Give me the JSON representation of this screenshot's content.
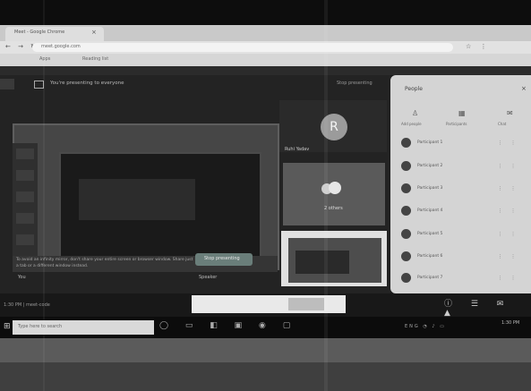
{
  "browser": {
    "tab_title": "Meet - Google Chrome",
    "tab_close": "×",
    "nav": "← → ↻",
    "url": "meet.google.com",
    "actions": "☆ ⋮",
    "bookmarks": [
      "Apps",
      "Reading list"
    ]
  },
  "meet": {
    "banner": "You're presenting to everyone",
    "stop_presenting_top": "Stop presenting",
    "slide_title": "",
    "warning": "To avoid an infinity mirror, don't share your entire screen or browser window. Share just a tab or a different window instead.",
    "stop_presenting_button": "Stop presenting",
    "you_label": "You",
    "speaker_label": "Speaker",
    "meeting_code": "1:30 PM | meet-code",
    "tiles": [
      {
        "initial": "R",
        "name": "Ruhi Yadav"
      },
      {
        "initial": "",
        "name": "2 others"
      }
    ]
  },
  "people_panel": {
    "title": "People",
    "close": "×",
    "tabs": [
      {
        "icon": "♙",
        "label": "Add people"
      },
      {
        "icon": "▦",
        "label": "Participants"
      },
      {
        "icon": "✉",
        "label": "Chat"
      }
    ],
    "participants": [
      {
        "name": "Participant 1"
      },
      {
        "name": "Participant 2"
      },
      {
        "name": "Participant 3"
      },
      {
        "name": "Participant 4"
      },
      {
        "name": "Participant 5"
      },
      {
        "name": "Participant 6"
      },
      {
        "name": "Participant 7"
      }
    ],
    "row_actions": "⋮ ⋮"
  },
  "controls": {
    "icons": "ⓘ ☰ ✉ ▲"
  },
  "taskbar": {
    "start": "⊞",
    "search_placeholder": "Type here to search",
    "apps": "◯ ▭ ◧ ▣ ◉ ▢",
    "tray": "ENG ◔ ♪ ▭",
    "time": "1:30 PM",
    "date": ""
  }
}
